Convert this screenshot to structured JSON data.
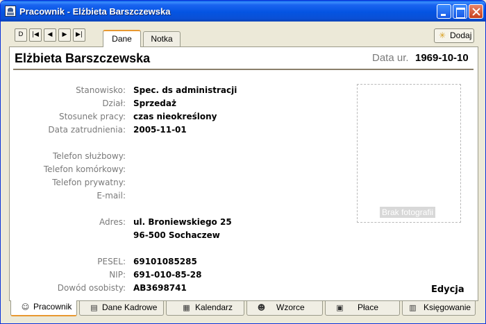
{
  "window": {
    "title": "Pracownik - Elżbieta Barszczewska"
  },
  "toolbar": {
    "nav": [
      "D",
      "|◀",
      "◀",
      "▶",
      "▶|"
    ],
    "tabs": [
      {
        "label": "Dane",
        "active": true
      },
      {
        "label": "Notka",
        "active": false
      }
    ],
    "add_label": "Dodaj"
  },
  "employee": {
    "name": "Elżbieta Barszczewska",
    "dob_label": "Data ur.",
    "dob_value": "1969-10-10"
  },
  "fields": [
    {
      "label": "Stanowisko:",
      "value": "Spec. ds administracji"
    },
    {
      "label": "Dział:",
      "value": "Sprzedaż"
    },
    {
      "label": "Stosunek pracy:",
      "value": "czas nieokreślony"
    },
    {
      "label": "Data zatrudnienia:",
      "value": "2005-11-01"
    },
    {
      "label": "Telefon służbowy:",
      "value": ""
    },
    {
      "label": "Telefon komórkowy:",
      "value": ""
    },
    {
      "label": "Telefon prywatny:",
      "value": ""
    },
    {
      "label": "E-mail:",
      "value": ""
    },
    {
      "label": "Adres:",
      "value": "ul. Broniewskiego 25",
      "value2": "96-500 Sochaczew"
    },
    {
      "label": "PESEL:",
      "value": "69101085285"
    },
    {
      "label": "NIP:",
      "value": "691-010-85-28"
    },
    {
      "label": "Dowód osobisty:",
      "value": "AB3698741"
    }
  ],
  "photo": {
    "label": "Brak fotografii"
  },
  "edit_label": "Edycja",
  "bottom_tabs": [
    {
      "label": "Pracownik",
      "icon": "person-icon",
      "active": true
    },
    {
      "label": "Dane Kadrowe",
      "icon": "document-icon",
      "active": false
    },
    {
      "label": "Kalendarz",
      "icon": "calendar-icon",
      "active": false
    },
    {
      "label": "Wzorce",
      "icon": "people-icon",
      "active": false
    },
    {
      "label": "Płace",
      "icon": "calculator-icon",
      "active": false
    },
    {
      "label": "Księgowanie",
      "icon": "ledger-icon",
      "active": false
    }
  ]
}
